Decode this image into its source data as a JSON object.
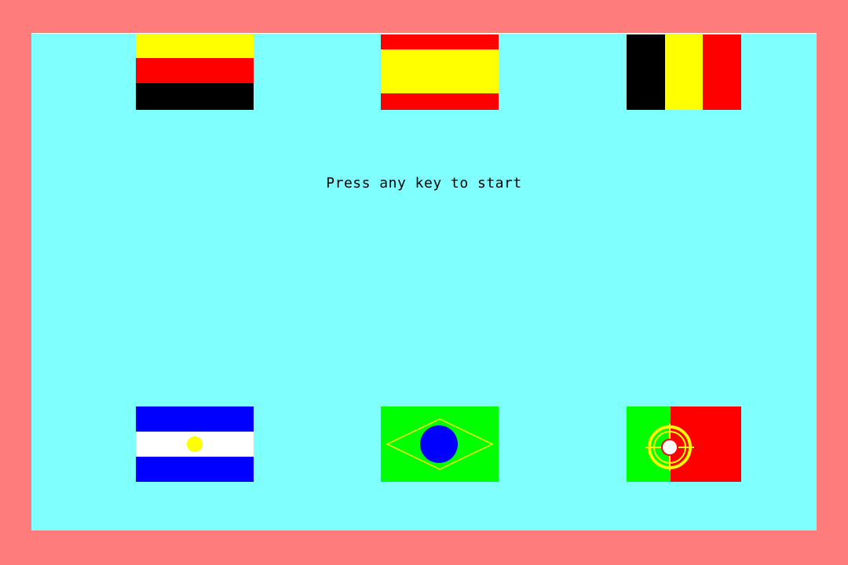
{
  "screen": {
    "prompt": "Press any key to start",
    "background_color": "#80ffff",
    "border_color": "#ff7c7c"
  },
  "flags": [
    {
      "name": "germany-flag",
      "colors": [
        "#ffff00",
        "#ff0000",
        "#000000"
      ]
    },
    {
      "name": "spain-flag",
      "colors": [
        "#ff0000",
        "#ffff00",
        "#ff0000"
      ]
    },
    {
      "name": "belgium-flag",
      "colors": [
        "#000000",
        "#ffff00",
        "#ff0000"
      ]
    },
    {
      "name": "argentina-flag",
      "colors": [
        "#0000ff",
        "#ffffff",
        "#0000ff",
        "#ffff00"
      ]
    },
    {
      "name": "brazil-flag",
      "colors": [
        "#00ff00",
        "#ffff00",
        "#0000ff"
      ]
    },
    {
      "name": "portugal-flag",
      "colors": [
        "#00ff00",
        "#ff0000",
        "#ffff00",
        "#ffffff"
      ]
    }
  ]
}
